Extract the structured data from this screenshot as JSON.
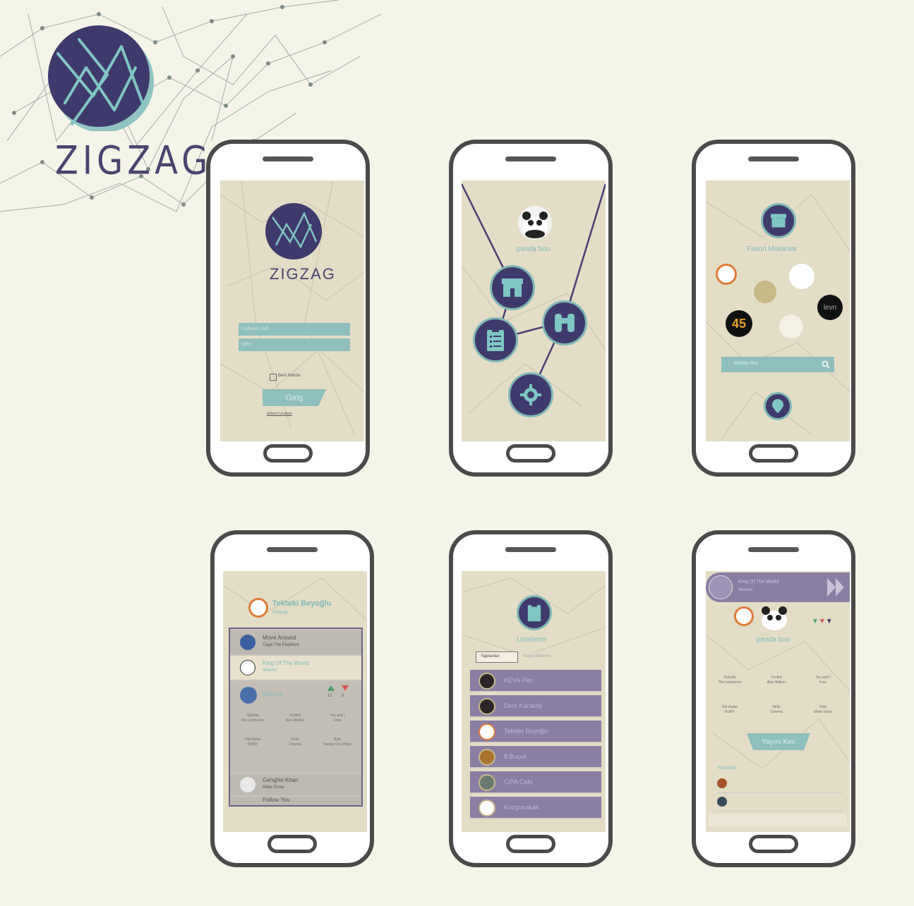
{
  "brand": {
    "name": "ZIGZAG"
  },
  "login": {
    "title": "ZIGZAG",
    "username_placeholder": "Kullanıcı Adı",
    "password_placeholder": "Şifre",
    "remember_label": "Beni Hatırla",
    "login_button": "Giriş",
    "forgot_link": "Şifremi Unuttum"
  },
  "menu": {
    "username": "panda boo"
  },
  "favorites": {
    "title": "Favori Mekanlar",
    "search_placeholder": "Mekan Ara",
    "logos": [
      "45",
      "levn"
    ]
  },
  "venue": {
    "name": "Tekteki Beyoğlu",
    "subtitle": "Cihangir",
    "tracks": [
      {
        "title": "Move Around",
        "artist": "Cage The Elephant"
      },
      {
        "title": "King Of The World",
        "artist": "Weezer"
      },
      {
        "title": "Seb ure",
        "artist": ""
      },
      {
        "title": "Genghis Khan",
        "artist": "Miike Snow"
      },
      {
        "title": "Follow You",
        "artist": ""
      }
    ],
    "votes": {
      "up": "12",
      "down": "8"
    },
    "grid": [
      [
        "Ophelia",
        "The Lumineers"
      ],
      [
        "Foxfird",
        "Alex Walker"
      ],
      [
        "You and I",
        "Free"
      ],
      [
        "Old Guitar",
        "RUBY"
      ],
      [
        "Hello",
        "Cinema"
      ],
      [
        "Ride",
        "Twenty One Pilots"
      ]
    ]
  },
  "lists": {
    "title": "Listelerim",
    "tabs": [
      "Yapılanlar",
      "Beğendiklerim"
    ],
    "items": [
      "KEVA Pier",
      "Dem Karaköy",
      "Tekteki Beyoğlu",
      "8 Buçuk",
      "CiPA Cafe",
      "Kuzgunakak"
    ]
  },
  "profile": {
    "now_playing_title": "King Of The World",
    "now_playing_artist": "Weezer",
    "username": "panda boo",
    "grid": [
      [
        "Ophelia",
        "The Lumineers"
      ],
      [
        "Foxfird",
        "Alex Walker"
      ],
      [
        "You and I",
        "Free"
      ],
      [
        "Old Guitar",
        "RUBY"
      ],
      [
        "Hello",
        "Cinema"
      ],
      [
        "Only",
        "Miike Snow"
      ]
    ],
    "action_button": "Yayını Kes",
    "comments_label": "Yorumlar"
  },
  "colors": {
    "navy": "#3f3a6c",
    "teal": "#7fb9b6",
    "beige": "#e3ddc6",
    "purple": "#8a7ea4",
    "bg": "#f5f4e8"
  }
}
